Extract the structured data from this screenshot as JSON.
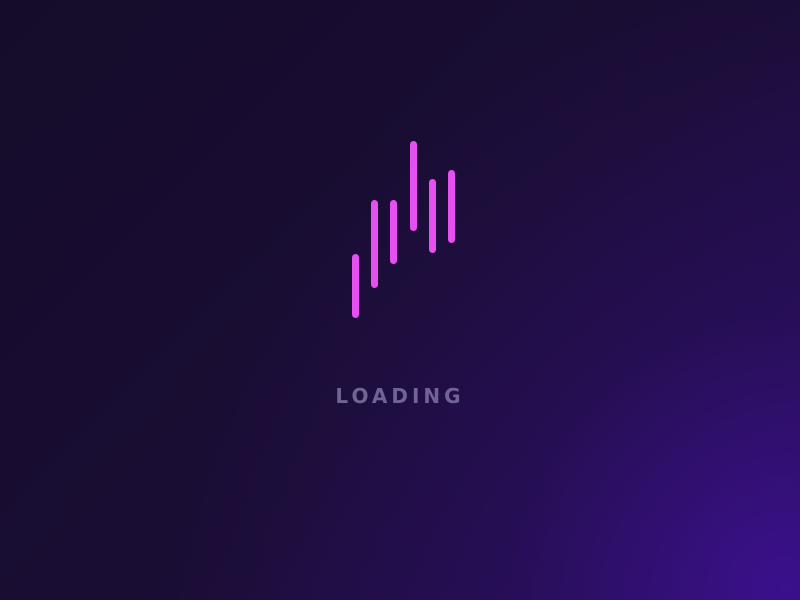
{
  "screen": {
    "status_text": "LOADING",
    "accent_color": "#e64ff0",
    "text_color": "#6f6495",
    "background_colors": [
      "#150c2a",
      "#250d55"
    ]
  },
  "spinner": {
    "icon_name": "loading-bars-icon",
    "bar_count": 6
  }
}
